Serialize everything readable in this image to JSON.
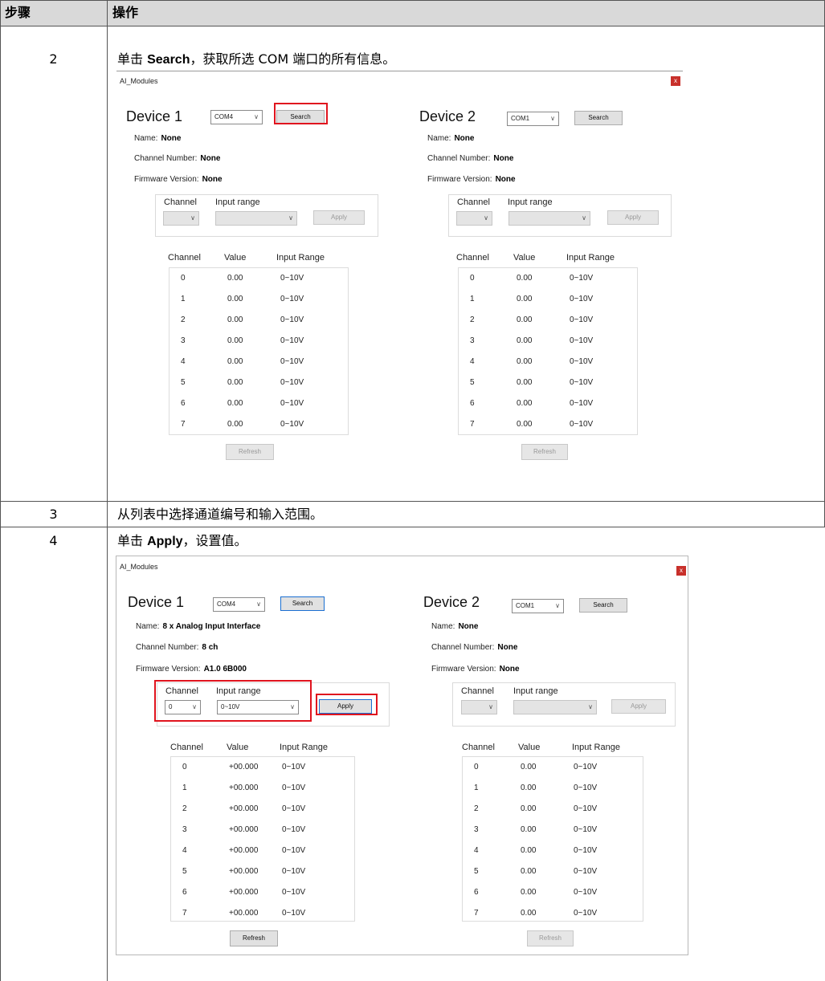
{
  "doc_table": {
    "headers": {
      "step": "步骤",
      "operation": "操作"
    },
    "rows": [
      {
        "step": "2",
        "text_pre": "单击 ",
        "bold": "Search",
        "text_post": "，获取所选 COM 端口的所有信息。"
      },
      {
        "step": "3",
        "text": "从列表中选择通道编号和输入范围。"
      },
      {
        "step": "4",
        "text_pre": "单击 ",
        "bold": "Apply",
        "text_post": "，设置值。"
      }
    ]
  },
  "labels": {
    "name": "Name:",
    "channel_number": "Channel Number:",
    "firmware_version": "Firmware Version:",
    "channel": "Channel",
    "input_range": "Input range",
    "col_channel": "Channel",
    "col_value": "Value",
    "col_input_range": "Input Range",
    "search": "Search",
    "apply": "Apply",
    "refresh": "Refresh",
    "close": "x"
  },
  "windows": [
    {
      "title": "AI_Modules",
      "devices": [
        {
          "title": "Device 1",
          "com": "COM4",
          "name": "None",
          "channel_number": "None",
          "firmware": "None",
          "sel_channel": "",
          "sel_range": "",
          "rows": [
            [
              "0",
              "0.00",
              "0~10V"
            ],
            [
              "1",
              "0.00",
              "0~10V"
            ],
            [
              "2",
              "0.00",
              "0~10V"
            ],
            [
              "3",
              "0.00",
              "0~10V"
            ],
            [
              "4",
              "0.00",
              "0~10V"
            ],
            [
              "5",
              "0.00",
              "0~10V"
            ],
            [
              "6",
              "0.00",
              "0~10V"
            ],
            [
              "7",
              "0.00",
              "0~10V"
            ]
          ]
        },
        {
          "title": "Device 2",
          "com": "COM1",
          "name": "None",
          "channel_number": "None",
          "firmware": "None",
          "sel_channel": "",
          "sel_range": "",
          "rows": [
            [
              "0",
              "0.00",
              "0~10V"
            ],
            [
              "1",
              "0.00",
              "0~10V"
            ],
            [
              "2",
              "0.00",
              "0~10V"
            ],
            [
              "3",
              "0.00",
              "0~10V"
            ],
            [
              "4",
              "0.00",
              "0~10V"
            ],
            [
              "5",
              "0.00",
              "0~10V"
            ],
            [
              "6",
              "0.00",
              "0~10V"
            ],
            [
              "7",
              "0.00",
              "0~10V"
            ]
          ]
        }
      ]
    },
    {
      "title": "AI_Modules",
      "devices": [
        {
          "title": "Device 1",
          "com": "COM4",
          "name": "8 x Analog Input Interface",
          "channel_number": "8 ch",
          "firmware": "A1.0 6B000",
          "sel_channel": "0",
          "sel_range": "0~10V",
          "rows": [
            [
              "0",
              "+00.000",
              "0~10V"
            ],
            [
              "1",
              "+00.000",
              "0~10V"
            ],
            [
              "2",
              "+00.000",
              "0~10V"
            ],
            [
              "3",
              "+00.000",
              "0~10V"
            ],
            [
              "4",
              "+00.000",
              "0~10V"
            ],
            [
              "5",
              "+00.000",
              "0~10V"
            ],
            [
              "6",
              "+00.000",
              "0~10V"
            ],
            [
              "7",
              "+00.000",
              "0~10V"
            ]
          ]
        },
        {
          "title": "Device 2",
          "com": "COM1",
          "name": "None",
          "channel_number": "None",
          "firmware": "None",
          "sel_channel": "",
          "sel_range": "",
          "rows": [
            [
              "0",
              "0.00",
              "0~10V"
            ],
            [
              "1",
              "0.00",
              "0~10V"
            ],
            [
              "2",
              "0.00",
              "0~10V"
            ],
            [
              "3",
              "0.00",
              "0~10V"
            ],
            [
              "4",
              "0.00",
              "0~10V"
            ],
            [
              "5",
              "0.00",
              "0~10V"
            ],
            [
              "6",
              "0.00",
              "0~10V"
            ],
            [
              "7",
              "0.00",
              "0~10V"
            ]
          ]
        }
      ]
    }
  ]
}
